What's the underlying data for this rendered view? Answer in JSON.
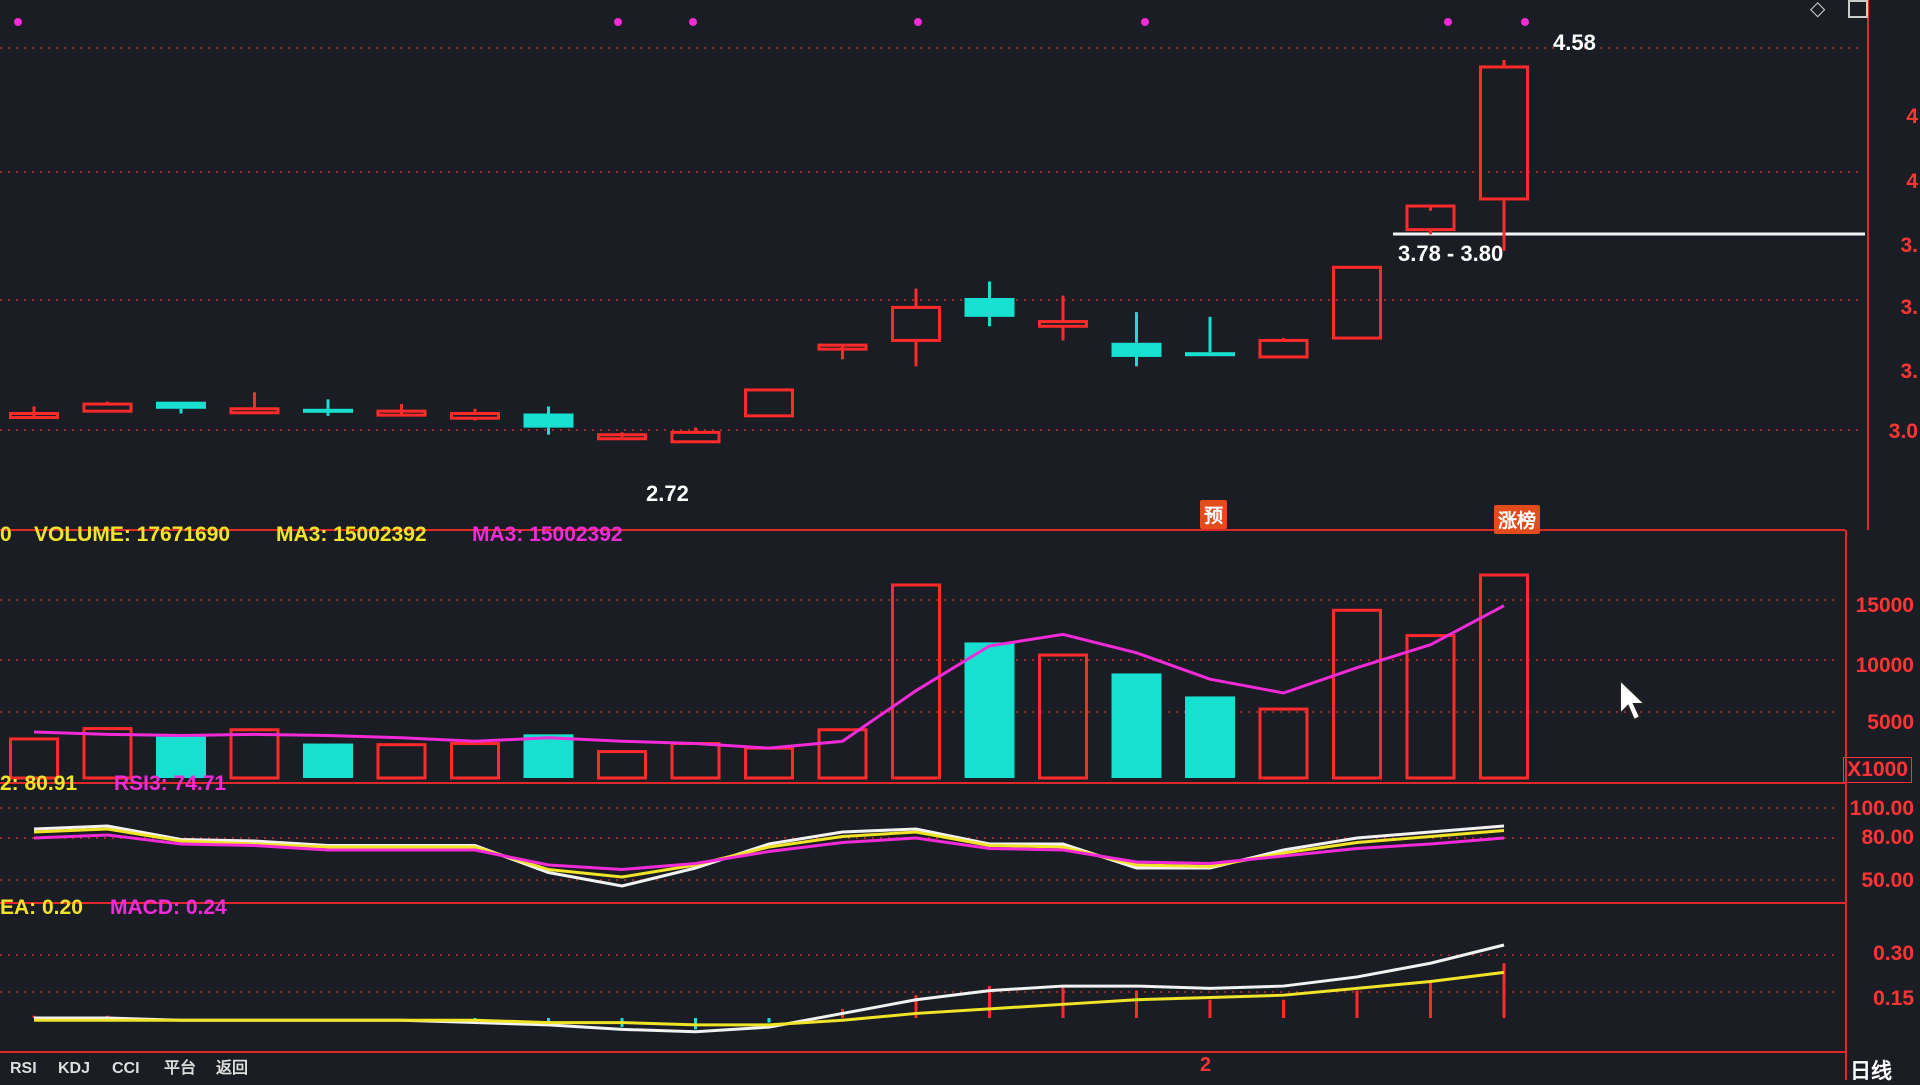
{
  "colors": {
    "background": "#1b1d24",
    "up": "#ff2a2a",
    "down": "#17e0d0",
    "grid": "#c23030",
    "ma_white": "#f2f2f2",
    "ma_yellow": "#f0e428",
    "ma_magenta": "#f22ad8",
    "axis": "#ff3434"
  },
  "header": {
    "volume_label": "VOLUME: 17671690",
    "ma3_yellow_label": "MA3: 15002392",
    "ma3_magenta_label": "MA3: 15002392",
    "rsi_left_label": "2: 80.91",
    "rsi3_label": "RSI3: 74.71",
    "dea_label": "EA: 0.20",
    "macd_label": "MACD: 0.24",
    "vol_prefix": "0"
  },
  "annotations": {
    "high_label": "4.58",
    "low_label": "2.72",
    "range_label": "3.78 - 3.80",
    "tag_pre": "预",
    "tag_limit": "涨榜",
    "bottom_marker": "2"
  },
  "axes": {
    "price_ticks": [
      "4",
      "4",
      "3.",
      "3.",
      "3.",
      "3.0"
    ],
    "volume_ticks": [
      "15000",
      "10000",
      "5000"
    ],
    "volume_unit": "X1000",
    "rsi_ticks": [
      "100.00",
      "80.00",
      "50.00"
    ],
    "macd_ticks": [
      "0.30",
      "0.15"
    ],
    "period_label": "日线"
  },
  "tabs": [
    "RSI",
    "KDJ",
    "CCI",
    "平台",
    "返回"
  ],
  "candles": [
    {
      "o": 3.07,
      "h": 3.1,
      "l": 3.05,
      "c": 3.07
    },
    {
      "o": 3.08,
      "h": 3.12,
      "l": 3.08,
      "c": 3.11
    },
    {
      "o": 3.12,
      "h": 3.12,
      "l": 3.07,
      "c": 3.09
    },
    {
      "o": 3.08,
      "h": 3.16,
      "l": 3.08,
      "c": 3.09
    },
    {
      "o": 3.09,
      "h": 3.13,
      "l": 3.06,
      "c": 3.08
    },
    {
      "o": 3.08,
      "h": 3.11,
      "l": 3.06,
      "c": 3.08
    },
    {
      "o": 3.05,
      "h": 3.09,
      "l": 3.04,
      "c": 3.07
    },
    {
      "o": 3.07,
      "h": 3.1,
      "l": 2.98,
      "c": 3.01
    },
    {
      "o": 2.98,
      "h": 2.99,
      "l": 2.97,
      "c": 2.98
    },
    {
      "o": 2.95,
      "h": 3.01,
      "l": 2.95,
      "c": 2.99
    },
    {
      "o": 3.06,
      "h": 3.17,
      "l": 3.06,
      "c": 3.17
    },
    {
      "o": 3.36,
      "h": 3.36,
      "l": 3.3,
      "c": 3.36
    },
    {
      "o": 3.38,
      "h": 3.6,
      "l": 3.27,
      "c": 3.52
    },
    {
      "o": 3.56,
      "h": 3.63,
      "l": 3.44,
      "c": 3.48
    },
    {
      "o": 3.44,
      "h": 3.57,
      "l": 3.38,
      "c": 3.46
    },
    {
      "o": 3.37,
      "h": 3.5,
      "l": 3.27,
      "c": 3.31
    },
    {
      "o": 3.33,
      "h": 3.48,
      "l": 3.32,
      "c": 3.32
    },
    {
      "o": 3.31,
      "h": 3.39,
      "l": 3.31,
      "c": 3.38
    },
    {
      "o": 3.39,
      "h": 3.69,
      "l": 3.39,
      "c": 3.69
    },
    {
      "o": 3.85,
      "h": 3.93,
      "l": 3.83,
      "c": 3.95
    },
    {
      "o": 3.98,
      "h": 4.57,
      "l": 3.76,
      "c": 4.54
    }
  ],
  "volume_k": [
    3400,
    4300,
    3600,
    4200,
    3000,
    2900,
    3000,
    3800,
    2300,
    3000,
    2600,
    4200,
    16800,
    11800,
    10700,
    9100,
    7100,
    6000,
    14600,
    12400,
    17671
  ],
  "volume_ma3_k": [
    4000,
    3800,
    3700,
    3800,
    3700,
    3500,
    3200,
    3500,
    3200,
    3000,
    2600,
    3200,
    7600,
    11500,
    12500,
    10900,
    8600,
    7400,
    9600,
    11600,
    15002
  ],
  "rsi": {
    "white": [
      84,
      86,
      77,
      76,
      73,
      73,
      73,
      55,
      46,
      58,
      74,
      82,
      84,
      74,
      74,
      58,
      58,
      70,
      78,
      82,
      86
    ],
    "yellow": [
      82,
      84,
      76,
      74,
      72,
      72,
      72,
      57,
      52,
      60,
      72,
      79,
      82,
      73,
      72,
      60,
      59,
      68,
      75,
      79,
      83
    ],
    "magenta": [
      78,
      80,
      74,
      73,
      70,
      70,
      70,
      60,
      57,
      61,
      69,
      75,
      78,
      71,
      70,
      62,
      61,
      66,
      71,
      74,
      78
    ]
  },
  "macd": {
    "dif": [
      0.0,
      0.0,
      -0.01,
      -0.01,
      -0.01,
      -0.01,
      -0.02,
      -0.03,
      -0.05,
      -0.06,
      -0.04,
      0.02,
      0.08,
      0.12,
      0.14,
      0.14,
      0.13,
      0.14,
      0.18,
      0.24,
      0.32
    ],
    "dea": [
      -0.01,
      -0.01,
      -0.01,
      -0.01,
      -0.01,
      -0.01,
      -0.01,
      -0.02,
      -0.02,
      -0.03,
      -0.03,
      -0.01,
      0.02,
      0.04,
      0.06,
      0.08,
      0.09,
      0.1,
      0.13,
      0.16,
      0.2
    ],
    "hist": [
      0.01,
      0.01,
      0.0,
      0.0,
      0.0,
      0.0,
      -0.01,
      -0.02,
      -0.04,
      -0.05,
      -0.02,
      0.04,
      0.1,
      0.14,
      0.14,
      0.12,
      0.08,
      0.08,
      0.12,
      0.16,
      0.24
    ]
  }
}
